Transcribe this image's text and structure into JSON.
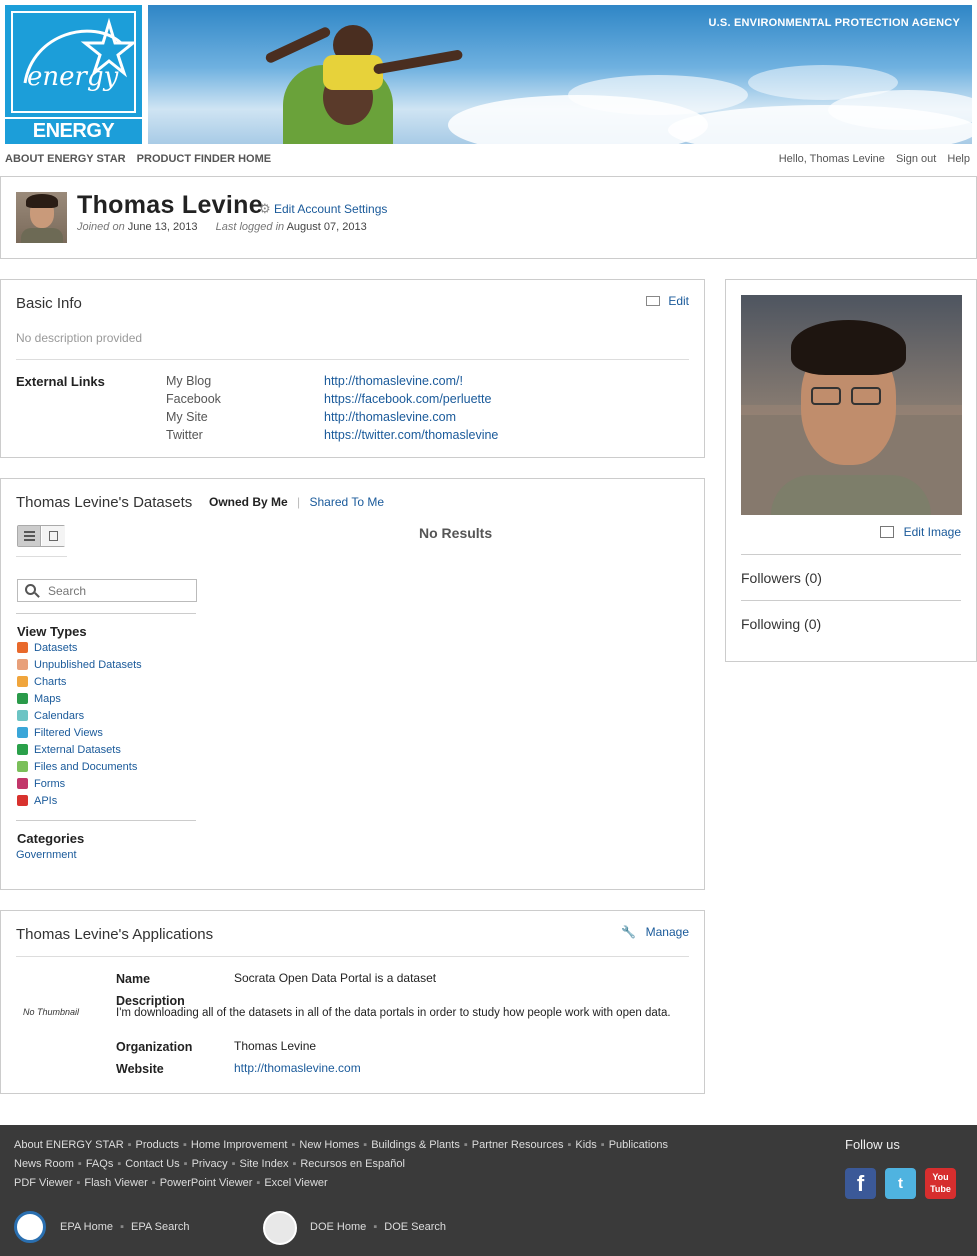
{
  "header": {
    "logo_text": "ENERGY STAR",
    "logo_script": "energy",
    "agency": "U.S. ENVIRONMENTAL PROTECTION AGENCY"
  },
  "topnav": {
    "about": "ABOUT ENERGY STAR",
    "product_finder": "PRODUCT FINDER HOME",
    "greeting": "Hello, Thomas Levine",
    "signout": "Sign out",
    "help": "Help"
  },
  "profile": {
    "name": "Thomas Levine",
    "edit_account": "Edit Account Settings",
    "joined_label": "Joined on",
    "joined_date": "June 13, 2013",
    "logged_label": "Last logged in",
    "logged_date": "August 07, 2013"
  },
  "basic_info": {
    "title": "Basic Info",
    "edit": "Edit",
    "description": "No description provided",
    "external_links_label": "External Links",
    "links": [
      {
        "label": "My Blog",
        "url": "http://thomaslevine.com/!"
      },
      {
        "label": "Facebook",
        "url": "https://facebook.com/perluette"
      },
      {
        "label": "My Site",
        "url": "http://thomaslevine.com"
      },
      {
        "label": "Twitter",
        "url": "https://twitter.com/thomaslevine"
      }
    ]
  },
  "datasets": {
    "title": "Thomas Levine's Datasets",
    "tab_owned": "Owned By Me",
    "tab_shared": "Shared To Me",
    "no_results": "No Results",
    "search_placeholder": "Search",
    "view_types_label": "View Types",
    "view_types": [
      {
        "label": "Datasets",
        "color": "#e8692b"
      },
      {
        "label": "Unpublished Datasets",
        "color": "#e8a07a"
      },
      {
        "label": "Charts",
        "color": "#f0a53c"
      },
      {
        "label": "Maps",
        "color": "#2a9a4a"
      },
      {
        "label": "Calendars",
        "color": "#6cc4c4"
      },
      {
        "label": "Filtered Views",
        "color": "#3aa6d8"
      },
      {
        "label": "External Datasets",
        "color": "#2aa04a"
      },
      {
        "label": "Files and Documents",
        "color": "#7bbf5a"
      },
      {
        "label": "Forms",
        "color": "#c2366a"
      },
      {
        "label": "APIs",
        "color": "#d8322e"
      }
    ],
    "categories_label": "Categories",
    "categories": [
      "Government"
    ]
  },
  "applications": {
    "title": "Thomas Levine's Applications",
    "manage": "Manage",
    "no_thumbnail": "No Thumbnail",
    "name_label": "Name",
    "name_value": "Socrata Open Data Portal is a dataset",
    "description_label": "Description",
    "description_value": "I'm downloading all of the datasets in all of the data portals in order to study how people work with open data.",
    "organization_label": "Organization",
    "organization_value": "Thomas Levine",
    "website_label": "Website",
    "website_value": "http://thomaslevine.com"
  },
  "side": {
    "edit_image": "Edit Image",
    "followers": "Followers (0)",
    "following": "Following (0)"
  },
  "footer": {
    "row1": [
      "About ENERGY STAR",
      "Products",
      "Home Improvement",
      "New Homes",
      "Buildings & Plants",
      "Partner Resources",
      "Kids",
      "Publications"
    ],
    "row2": [
      "News Room",
      "FAQs",
      "Contact Us",
      "Privacy",
      "Site Index",
      "Recursos en Español"
    ],
    "row3": [
      "PDF Viewer",
      "Flash Viewer",
      "PowerPoint Viewer",
      "Excel Viewer"
    ],
    "follow_us": "Follow us",
    "epa_links": [
      "EPA Home",
      "EPA Search"
    ],
    "doe_links": [
      "DOE Home",
      "DOE Search"
    ],
    "youtube_label_1": "You",
    "youtube_label_2": "Tube"
  }
}
